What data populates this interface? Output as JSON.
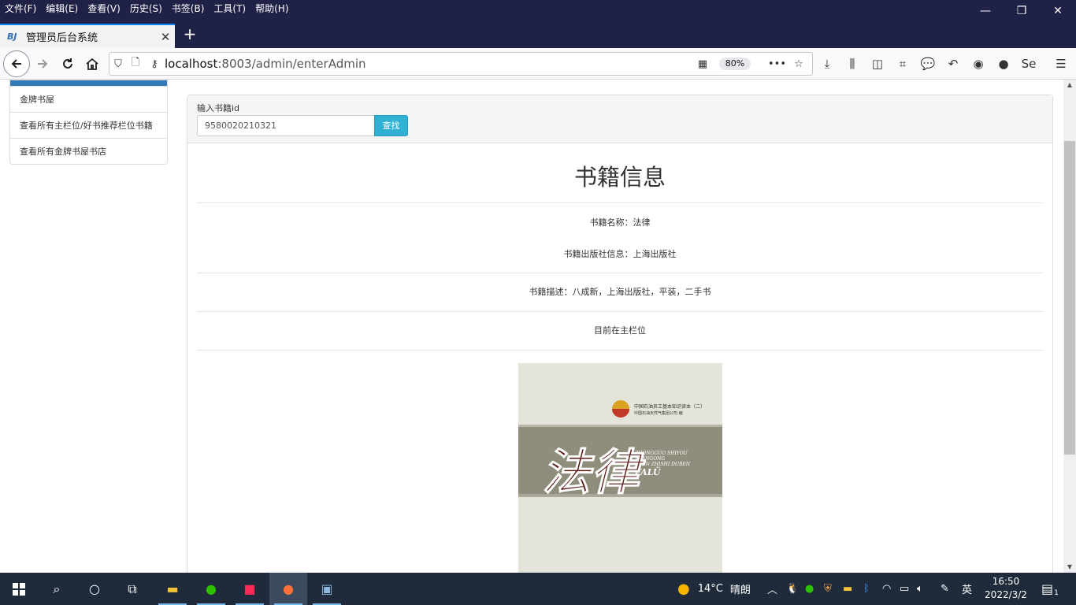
{
  "menu": [
    "文件(F)",
    "编辑(E)",
    "查看(V)",
    "历史(S)",
    "书签(B)",
    "工具(T)",
    "帮助(H)"
  ],
  "window": {
    "minimize": "—",
    "restore": "❐",
    "close": "✕"
  },
  "tab": {
    "favicon": "BJ",
    "title": "管理员后台系统",
    "close": "✕",
    "new": "+"
  },
  "urlbar": {
    "host": "localhost",
    "path": ":8003/admin/enterAdmin",
    "zoom": "80%"
  },
  "sidebar": {
    "items": [
      "金牌书屋",
      "查看所有主栏位/好书推荐栏位书籍",
      "查看所有金牌书屋书店"
    ]
  },
  "search": {
    "label": "输入书籍id",
    "value": "9580020210321",
    "button": "查找"
  },
  "book": {
    "heading": "书籍信息",
    "name": "书籍名称：法律",
    "publisher": "书籍出版社信息：上海出版社",
    "description": "书籍描述：八成新，上海出版社，平装，二手书",
    "status": "目前在主栏位"
  },
  "cover": {
    "series": "中国石油员工基本知识读本（二）",
    "org": "中国石油天然气集团公司 编",
    "pinyin1": "ZHONGGUO SHIYOU",
    "pinyin2": "YUANGONG",
    "pinyin3": "JIBEN ZHISHI DUBEN",
    "pinyin4": "FALÜ",
    "title_chars": "法律"
  },
  "taskbar": {
    "weather": "14°C",
    "weather_text": "晴朗",
    "ime": "英",
    "time": "16:50",
    "date": "2022/3/2",
    "notify_count": "1"
  },
  "colors": {
    "accent": "#337ab7",
    "button": "#31b0d5",
    "titlebar": "#1f2147",
    "taskbar": "#1f2b3a"
  }
}
